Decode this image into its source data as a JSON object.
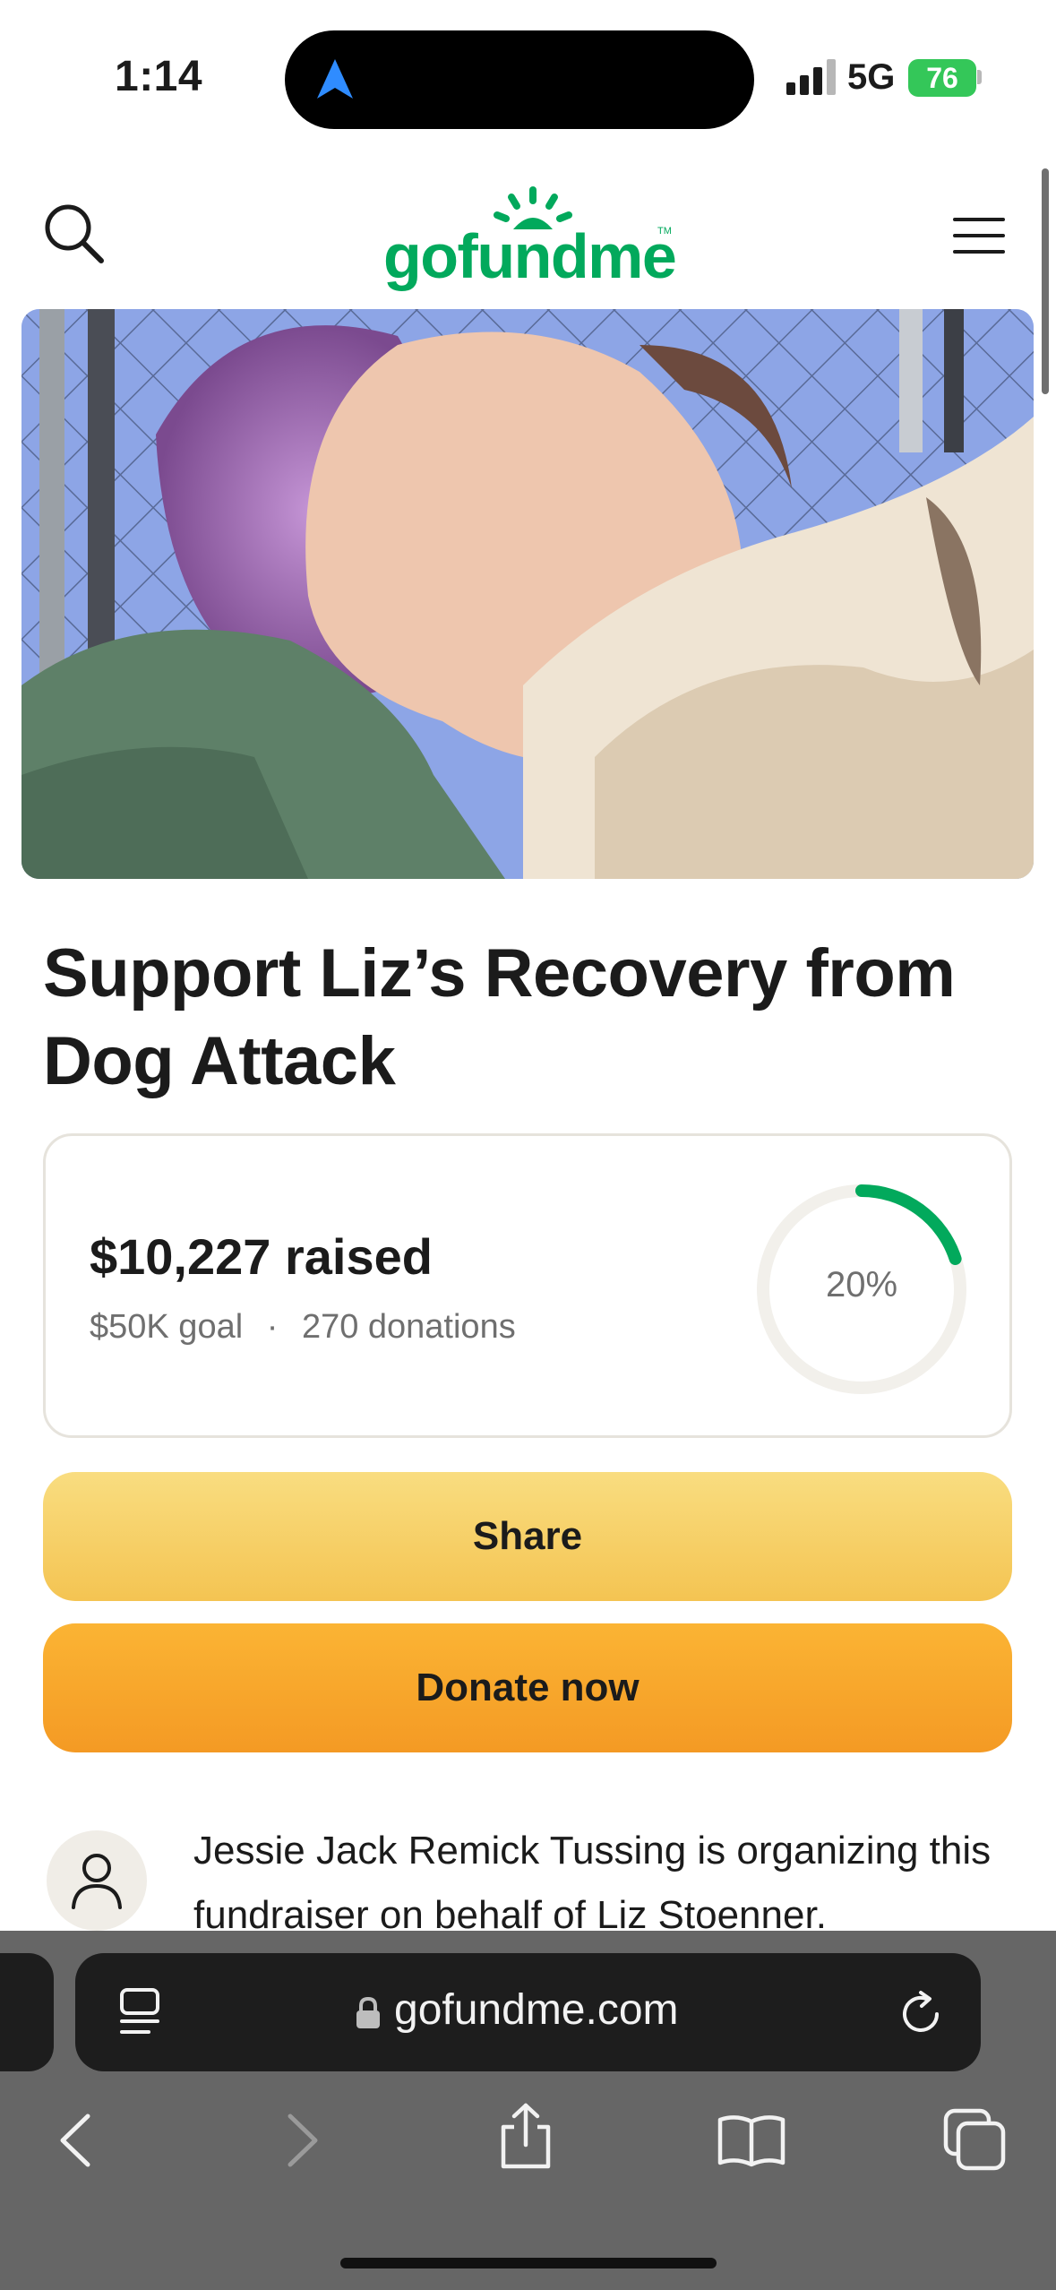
{
  "status_bar": {
    "time": "1:14",
    "network": "5G",
    "battery": "76",
    "icons": [
      "location-arrow-icon",
      "signal-bars-icon",
      "battery-charging-icon"
    ]
  },
  "header": {
    "logo_text": "gofundme",
    "logo_mark": "TM",
    "icons": [
      "search-icon",
      "menu-icon"
    ]
  },
  "campaign": {
    "title": "Support Liz’s Recovery from Dog Attack",
    "raised": "$10,227 raised",
    "goal": "$50K goal",
    "separator": "·",
    "donations": "270 donations",
    "progress_fraction": 0.2,
    "progress_label": "20%",
    "share_label": "Share",
    "donate_label": "Donate now",
    "organizer_text": "Jessie Jack Remick Tussing is organizing this fundraiser on behalf of Liz Stoenner."
  },
  "browser": {
    "url": "gofundme.com",
    "icons": [
      "tab-overview-icon",
      "lock-icon",
      "reload-icon",
      "back-icon",
      "forward-icon",
      "share-icon",
      "bookmarks-icon",
      "tabs-icon"
    ]
  },
  "colors": {
    "brand_green": "#02a95c",
    "share_yellow": "#f6cf63",
    "donate_orange": "#f7a72c",
    "battery_green": "#34c759"
  }
}
